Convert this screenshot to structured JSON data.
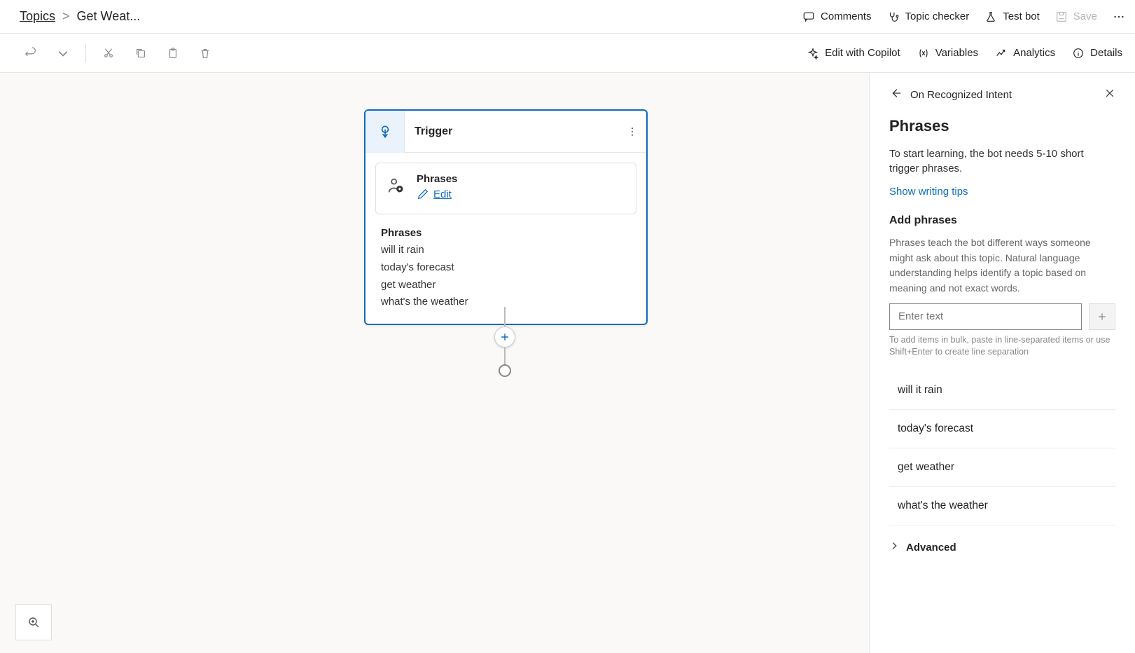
{
  "breadcrumb": {
    "root": "Topics",
    "current": "Get Weat..."
  },
  "topActions": {
    "comments": "Comments",
    "topicChecker": "Topic checker",
    "testBot": "Test bot",
    "save": "Save"
  },
  "toolbarRight": {
    "editCopilot": "Edit with Copilot",
    "variables": "Variables",
    "analytics": "Analytics",
    "details": "Details"
  },
  "node": {
    "title": "Trigger",
    "sub": {
      "title": "Phrases",
      "edit": "Edit"
    },
    "listTitle": "Phrases",
    "phrases": [
      "will it rain",
      "today's forecast",
      "get weather",
      "what's the weather"
    ]
  },
  "panel": {
    "header": "On Recognized Intent",
    "h1": "Phrases",
    "desc": "To start learning, the bot needs 5-10 short trigger phrases.",
    "tipsLink": "Show writing tips",
    "addTitle": "Add phrases",
    "help": "Phrases teach the bot different ways someone might ask about this topic. Natural language understanding helps identify a topic based on meaning and not exact words.",
    "inputPlaceholder": "Enter text",
    "hint": "To add items in bulk, paste in line-separated items or use Shift+Enter to create line separation",
    "phrases": [
      "will it rain",
      "today's forecast",
      "get weather",
      "what's the weather"
    ],
    "advanced": "Advanced"
  }
}
